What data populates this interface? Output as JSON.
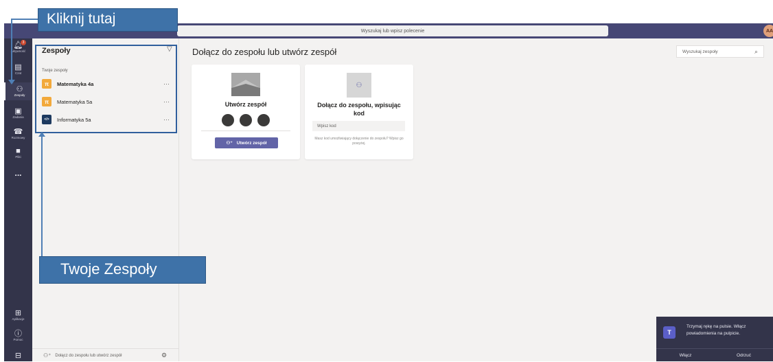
{
  "topbar": {
    "search_placeholder": "Wyszukaj lub wpisz polecenie",
    "avatar_initials": "AA"
  },
  "rail": {
    "items": [
      {
        "label": "Aktywność",
        "icon": "bell-icon",
        "badge": "3"
      },
      {
        "label": "Czat",
        "icon": "chat-icon"
      },
      {
        "label": "Zespoły",
        "icon": "teams-icon"
      },
      {
        "label": "Zadania",
        "icon": "assignments-icon"
      },
      {
        "label": "Rozmowy",
        "icon": "phone-icon"
      },
      {
        "label": "Pliki",
        "icon": "files-icon"
      },
      {
        "label": "...",
        "icon": "more-icon"
      }
    ],
    "bottom": [
      {
        "label": "Aplikacje",
        "icon": "apps-icon"
      },
      {
        "label": "Pomoc",
        "icon": "help-icon"
      }
    ]
  },
  "teams_panel": {
    "title": "Zespoły",
    "section_label": "Twoje zespoły",
    "teams": [
      {
        "name": "Matematyka 4a",
        "avatar_color": "#f2a93b",
        "avatar_glyph": "π",
        "more": "···"
      },
      {
        "name": "Matematyka 5a",
        "avatar_color": "#f2a93b",
        "avatar_glyph": "π",
        "more": "···"
      },
      {
        "name": "Informatyka 5a",
        "avatar_color": "#1e3a5f",
        "avatar_glyph": "</>",
        "more": "···"
      }
    ],
    "footer_label": "Dołącz do zespołu lub utwórz zespół"
  },
  "main": {
    "title": "Dołącz do zespołu lub utwórz zespół",
    "search_placeholder": "Wyszukaj zespoły",
    "create_card": {
      "heading": "Utwórz zespół",
      "button_label": "Utwórz zespół"
    },
    "join_card": {
      "heading": "Dołącz do zespołu, wpisując kod",
      "input_placeholder": "Wpisz kod",
      "help_text": "Masz kod umożliwiający dołączenie do zespołu? Wpisz go powyżej."
    }
  },
  "toast": {
    "message": "Trzymaj rękę na pulsie. Włącz powiadomienia na pulpicie.",
    "accept_label": "Włącz",
    "dismiss_label": "Odrzuć"
  },
  "annotations": {
    "click_here": "Kliknij tutaj",
    "your_teams": "Twoje Zespoły"
  },
  "colors": {
    "accent": "#6264a7",
    "rail_bg": "#33344a",
    "topbar_bg": "#464775",
    "callout_bg": "#3e72a8"
  }
}
